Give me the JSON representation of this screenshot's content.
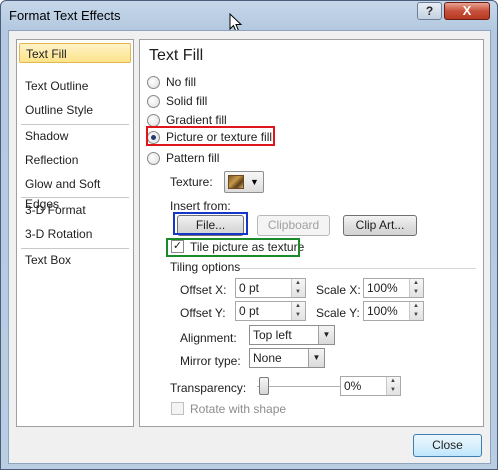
{
  "window": {
    "title": "Format Text Effects",
    "help_label": "?",
    "close_label": "X"
  },
  "nav": {
    "items": [
      {
        "label": "Text Fill",
        "selected": true
      },
      {
        "label": "Text Outline"
      },
      {
        "label": "Outline Style"
      },
      {
        "label": "Shadow"
      },
      {
        "label": "Reflection"
      },
      {
        "label": "Glow and Soft Edges"
      },
      {
        "label": "3-D Format"
      },
      {
        "label": "3-D Rotation"
      },
      {
        "label": "Text Box"
      }
    ]
  },
  "panel": {
    "title": "Text Fill",
    "fill_options": [
      {
        "label": "No fill",
        "checked": false
      },
      {
        "label": "Solid fill",
        "checked": false
      },
      {
        "label": "Gradient fill",
        "checked": false
      },
      {
        "label": "Picture or texture fill",
        "checked": true
      },
      {
        "label": "Pattern fill",
        "checked": false
      }
    ],
    "texture_label": "Texture:",
    "insert_from_label": "Insert from:",
    "file_button": "File...",
    "clipboard_button": "Clipboard",
    "clipart_button": "Clip Art...",
    "tile_checkbox_label": "Tile picture as texture",
    "tile_checked": true,
    "tiling_options_label": "Tiling options",
    "offset_x_label": "Offset X:",
    "offset_x_value": "0 pt",
    "offset_y_label": "Offset Y:",
    "offset_y_value": "0 pt",
    "scale_x_label": "Scale X:",
    "scale_x_value": "100%",
    "scale_y_label": "Scale Y:",
    "scale_y_value": "100%",
    "alignment_label": "Alignment:",
    "alignment_value": "Top left",
    "mirror_type_label": "Mirror type:",
    "mirror_type_value": "None",
    "transparency_label": "Transparency:",
    "transparency_value": "0%",
    "transparency_fraction": 0,
    "rotate_with_shape_label": "Rotate with shape",
    "rotate_with_shape_checked": false
  },
  "footer": {
    "close_button": "Close"
  },
  "highlight_colors": {
    "picture_fill": "#e0141b",
    "file_button": "#1437c9",
    "tile_checkbox": "#1a8a2a"
  }
}
